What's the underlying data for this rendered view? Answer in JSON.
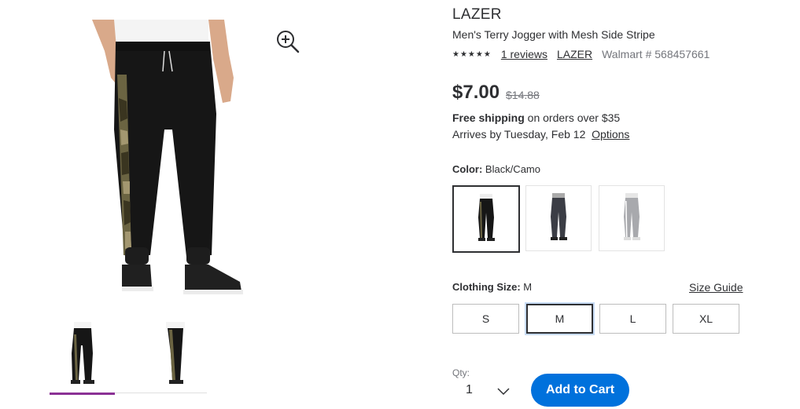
{
  "product": {
    "brand": "LAZER",
    "name": "Men's Terry Jogger with Mesh Side Stripe",
    "rating_stars": "★★★★★",
    "reviews_link": "1 reviews",
    "brand_link": "LAZER",
    "sku": "Walmart # 568457661"
  },
  "pricing": {
    "price": "$7.00",
    "was_price": "$14.88"
  },
  "shipping": {
    "free_label": "Free shipping",
    "free_rest": " on orders over $35",
    "arrives": "Arrives by Tuesday, Feb 12",
    "options_link": "Options"
  },
  "color": {
    "label": "Color:",
    "selected": "Black/Camo",
    "swatches": [
      "Black/Camo",
      "Charcoal",
      "Heather Gray"
    ]
  },
  "size": {
    "label": "Clothing Size:",
    "selected": "M",
    "guide_link": "Size Guide",
    "options": [
      "S",
      "M",
      "L",
      "XL"
    ]
  },
  "quantity": {
    "label": "Qty:",
    "value": "1"
  },
  "actions": {
    "add_to_cart": "Add to Cart"
  },
  "colors": {
    "accent": "#0071dc",
    "thumb_indicator": "#8b3195",
    "text": "#2e2f32",
    "muted": "#74767c"
  },
  "icons": {
    "zoom": "zoom-in-icon",
    "qty_chevron": "chevron-down-icon"
  }
}
